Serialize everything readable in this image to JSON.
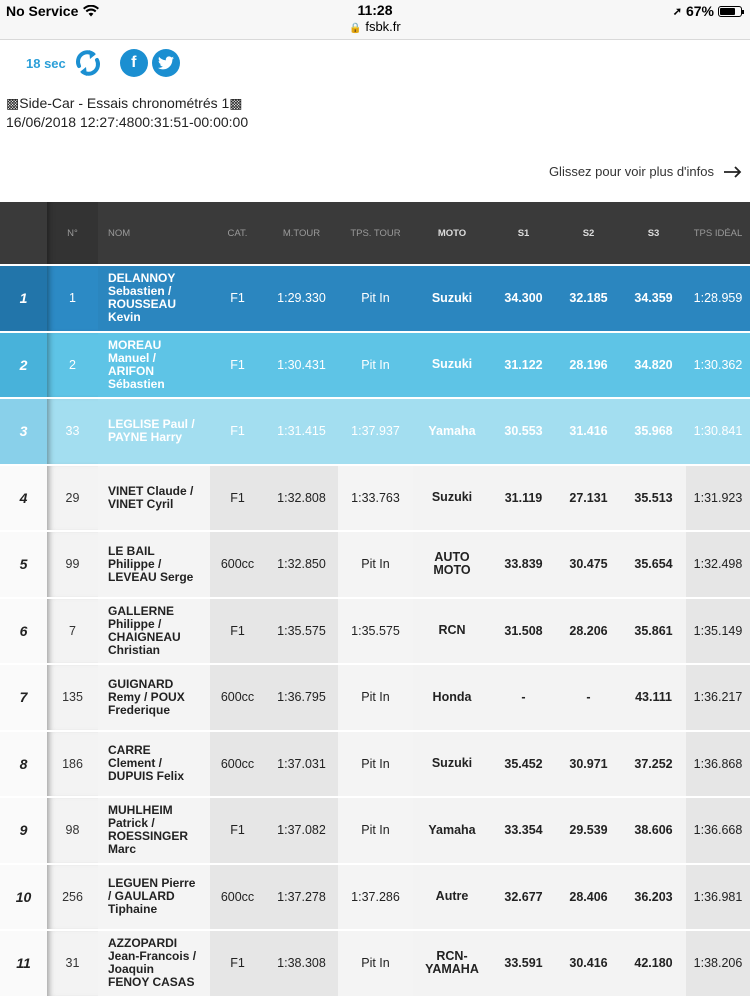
{
  "status_bar": {
    "carrier": "No Service",
    "time": "11:28",
    "url": "fsbk.fr",
    "battery": "67%",
    "battery_level": 0.67
  },
  "controls": {
    "refresh_interval": "18 sec",
    "refresh_icon": "refresh-icon",
    "facebook_label": "f",
    "twitter_icon": "twitter-icon"
  },
  "session": {
    "title": "▩Side-Car - Essais chronométrés 1▩",
    "date": "16/06/2018 12:27:4800:31:51-00:00:00"
  },
  "swipe_hint": "Glissez pour voir plus d'infos",
  "table": {
    "headers": {
      "pos": "",
      "num": "N°",
      "name": "NOM",
      "cat": "CAT.",
      "best_lap": "M.TOUR",
      "lap_time": "TPS. TOUR",
      "moto": "MOTO",
      "s1": "S1",
      "s2": "S2",
      "s3": "S3",
      "ideal": "TPS IDÉAL"
    },
    "rows": [
      {
        "pos": "1",
        "num": "1",
        "name": [
          "DELANNOY",
          "Sebastien /",
          "ROUSSEAU",
          "Kevin"
        ],
        "cat": "F1",
        "best_lap": "1:29.330",
        "lap_time": "Pit In",
        "moto": [
          "Suzuki"
        ],
        "s1": "34.300",
        "s2": "32.185",
        "s3": "34.359",
        "ideal": "1:28.959"
      },
      {
        "pos": "2",
        "num": "2",
        "name": [
          "MOREAU",
          "Manuel /",
          "ARIFON",
          "Sébastien"
        ],
        "cat": "F1",
        "best_lap": "1:30.431",
        "lap_time": "Pit In",
        "moto": [
          "Suzuki"
        ],
        "s1": "31.122",
        "s2": "28.196",
        "s3": "34.820",
        "ideal": "1:30.362"
      },
      {
        "pos": "3",
        "num": "33",
        "name": [
          "LEGLISE Paul /",
          "PAYNE Harry"
        ],
        "cat": "F1",
        "best_lap": "1:31.415",
        "lap_time": "1:37.937",
        "moto": [
          "Yamaha"
        ],
        "s1": "30.553",
        "s2": "31.416",
        "s3": "35.968",
        "ideal": "1:30.841"
      },
      {
        "pos": "4",
        "num": "29",
        "name": [
          "VINET Claude /",
          "VINET Cyril"
        ],
        "cat": "F1",
        "best_lap": "1:32.808",
        "lap_time": "1:33.763",
        "moto": [
          "Suzuki"
        ],
        "s1": "31.119",
        "s2": "27.131",
        "s3": "35.513",
        "ideal": "1:31.923"
      },
      {
        "pos": "5",
        "num": "99",
        "name": [
          "LE BAIL",
          "Philippe /",
          "LEVEAU Serge"
        ],
        "cat": "600cc",
        "best_lap": "1:32.850",
        "lap_time": "Pit In",
        "moto": [
          "AUTO",
          "MOTO"
        ],
        "s1": "33.839",
        "s2": "30.475",
        "s3": "35.654",
        "ideal": "1:32.498"
      },
      {
        "pos": "6",
        "num": "7",
        "name": [
          "GALLERNE",
          "Philippe /",
          "CHAIGNEAU",
          "Christian"
        ],
        "cat": "F1",
        "best_lap": "1:35.575",
        "lap_time": "1:35.575",
        "moto": [
          "RCN"
        ],
        "s1": "31.508",
        "s2": "28.206",
        "s3": "35.861",
        "ideal": "1:35.149"
      },
      {
        "pos": "7",
        "num": "135",
        "name": [
          "GUIGNARD",
          "Remy / POUX",
          "Frederique"
        ],
        "cat": "600cc",
        "best_lap": "1:36.795",
        "lap_time": "Pit In",
        "moto": [
          "Honda"
        ],
        "s1": "-",
        "s2": "-",
        "s3": "43.111",
        "ideal": "1:36.217"
      },
      {
        "pos": "8",
        "num": "186",
        "name": [
          "CARRE",
          "Clement /",
          "DUPUIS Felix"
        ],
        "cat": "600cc",
        "best_lap": "1:37.031",
        "lap_time": "Pit In",
        "moto": [
          "Suzuki"
        ],
        "s1": "35.452",
        "s2": "30.971",
        "s3": "37.252",
        "ideal": "1:36.868"
      },
      {
        "pos": "9",
        "num": "98",
        "name": [
          "MUHLHEIM",
          "Patrick /",
          "ROESSINGER",
          "Marc"
        ],
        "cat": "F1",
        "best_lap": "1:37.082",
        "lap_time": "Pit In",
        "moto": [
          "Yamaha"
        ],
        "s1": "33.354",
        "s2": "29.539",
        "s3": "38.606",
        "ideal": "1:36.668"
      },
      {
        "pos": "10",
        "num": "256",
        "name": [
          "LEGUEN Pierre",
          "/ GAULARD",
          "Tiphaine"
        ],
        "cat": "600cc",
        "best_lap": "1:37.278",
        "lap_time": "1:37.286",
        "moto": [
          "Autre"
        ],
        "s1": "32.677",
        "s2": "28.406",
        "s3": "36.203",
        "ideal": "1:36.981"
      },
      {
        "pos": "11",
        "num": "31",
        "name": [
          "AZZOPARDI",
          "Jean-Francois /",
          "Joaquin",
          "FENOY CASAS"
        ],
        "cat": "F1",
        "best_lap": "1:38.308",
        "lap_time": "Pit In",
        "moto": [
          "RCN-",
          "YAMAHA"
        ],
        "s1": "33.591",
        "s2": "30.416",
        "s3": "42.180",
        "ideal": "1:38.206"
      }
    ]
  },
  "colors": {
    "accent": "#2c9fd8",
    "header_bg": "#3a3a3a",
    "row1": "#2b86bf",
    "row2": "#5ec4e6",
    "row3": "#a3def0"
  }
}
